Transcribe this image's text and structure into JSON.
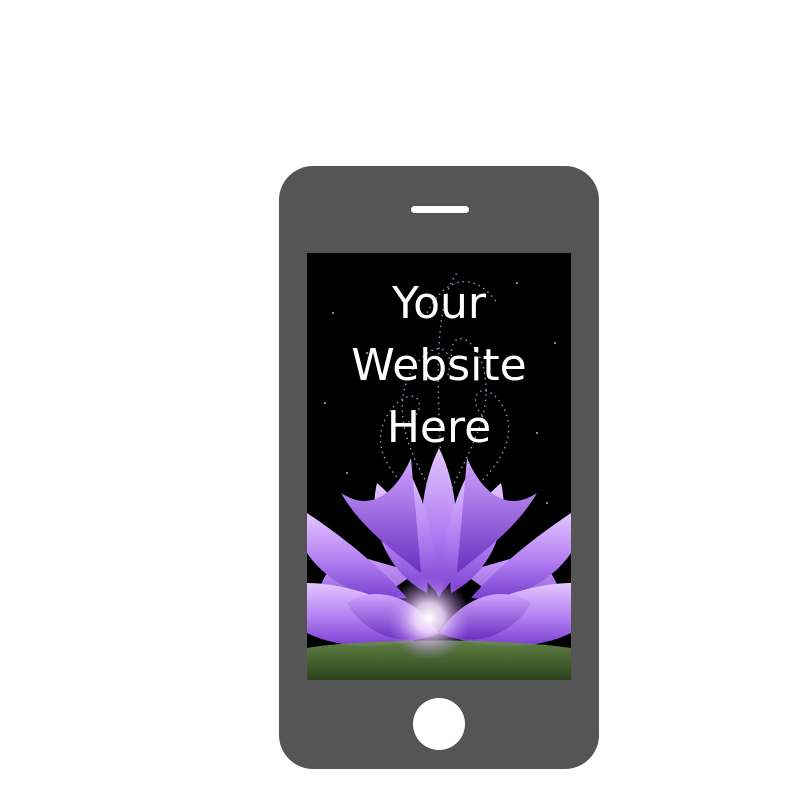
{
  "screen": {
    "headline_lines": [
      "Your",
      "Website",
      "Here"
    ]
  },
  "colors": {
    "phone_body": "#555555",
    "screen_background": "#000000",
    "text": "#ffffff",
    "flower_petal": "#b37ff2",
    "flower_petal_dark": "#7a3fd0",
    "flower_center_glow": "#fff8ff"
  },
  "image": {
    "subject": "purple-lotus-flower-with-sparkle-swirls"
  }
}
